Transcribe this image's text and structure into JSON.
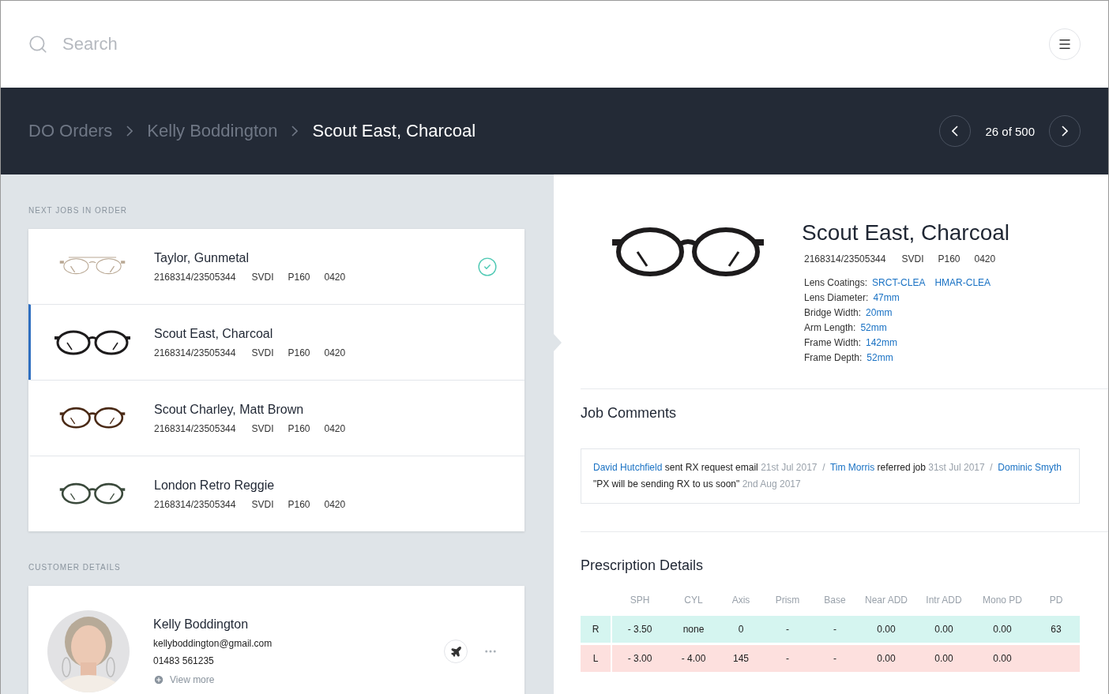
{
  "search": {
    "placeholder": "Search"
  },
  "breadcrumb": [
    {
      "label": "DO Orders",
      "selected": false
    },
    {
      "label": "Kelly Boddington",
      "selected": false
    },
    {
      "label": "Scout East, Charcoal",
      "selected": true
    }
  ],
  "pager": {
    "label": "26 of 500"
  },
  "next_jobs": {
    "title": "NEXT JOBS IN ORDER",
    "items": [
      {
        "name": "Taylor, Gunmetal",
        "codes": [
          "2168314/23505344",
          "SVDI",
          "P160",
          "0420"
        ],
        "selected": false,
        "done": true
      },
      {
        "name": "Scout East, Charcoal",
        "codes": [
          "2168314/23505344",
          "SVDI",
          "P160",
          "0420"
        ],
        "selected": true,
        "done": false
      },
      {
        "name": "Scout Charley, Matt Brown",
        "codes": [
          "2168314/23505344",
          "SVDI",
          "P160",
          "0420"
        ],
        "selected": false,
        "done": false
      },
      {
        "name": "London Retro Reggie",
        "codes": [
          "2168314/23505344",
          "SVDI",
          "P160",
          "0420"
        ],
        "selected": false,
        "done": false
      }
    ]
  },
  "customer": {
    "title": "CUSTOMER DETAILS",
    "name": "Kelly Boddington",
    "email": "kellyboddington@gmail.com",
    "phone": "01483 561235",
    "view_more": "View more"
  },
  "product": {
    "title": "Scout East, Charcoal",
    "codes": [
      "2168314/23505344",
      "SVDI",
      "P160",
      "0420"
    ],
    "specs": [
      {
        "label": "Lens Coatings:",
        "values": [
          "SRCT-CLEA",
          "HMAR-CLEA"
        ]
      },
      {
        "label": "Lens Diameter:",
        "values": [
          "47mm"
        ]
      },
      {
        "label": "Bridge Width:",
        "values": [
          "20mm"
        ]
      },
      {
        "label": "Arm Length:",
        "values": [
          "52mm"
        ]
      },
      {
        "label": "Frame Width:",
        "values": [
          "142mm"
        ]
      },
      {
        "label": "Frame Depth:",
        "values": [
          "52mm"
        ]
      }
    ]
  },
  "comments": {
    "title": "Job Comments",
    "entries": [
      {
        "author": "David Hutchfield",
        "text": "sent RX request email",
        "date": "21st Jul 2017",
        "separator": "/"
      },
      {
        "author": "Tim Morris",
        "text": "referred job",
        "date": "31st Jul 2017",
        "separator": "/"
      },
      {
        "author": "Dominic Smyth",
        "text": "\"PX will be sending RX to us soon\"",
        "date": "2nd Aug 2017"
      }
    ]
  },
  "prescription": {
    "title": "Prescription Details",
    "columns": [
      "SPH",
      "CYL",
      "Axis",
      "Prism",
      "Base",
      "Near ADD",
      "Intr ADD",
      "Mono PD",
      "PD"
    ],
    "rows": [
      {
        "eye": "R",
        "color": "#d5f5f0",
        "values": [
          "- 3.50",
          "none",
          "0",
          "-",
          "-",
          "0.00",
          "0.00",
          "0.00",
          "63"
        ]
      },
      {
        "eye": "L",
        "color": "#fde0de",
        "values": [
          "- 3.00",
          "- 4.00",
          "145",
          "-",
          "-",
          "0.00",
          "0.00",
          "0.00"
        ]
      }
    ]
  }
}
